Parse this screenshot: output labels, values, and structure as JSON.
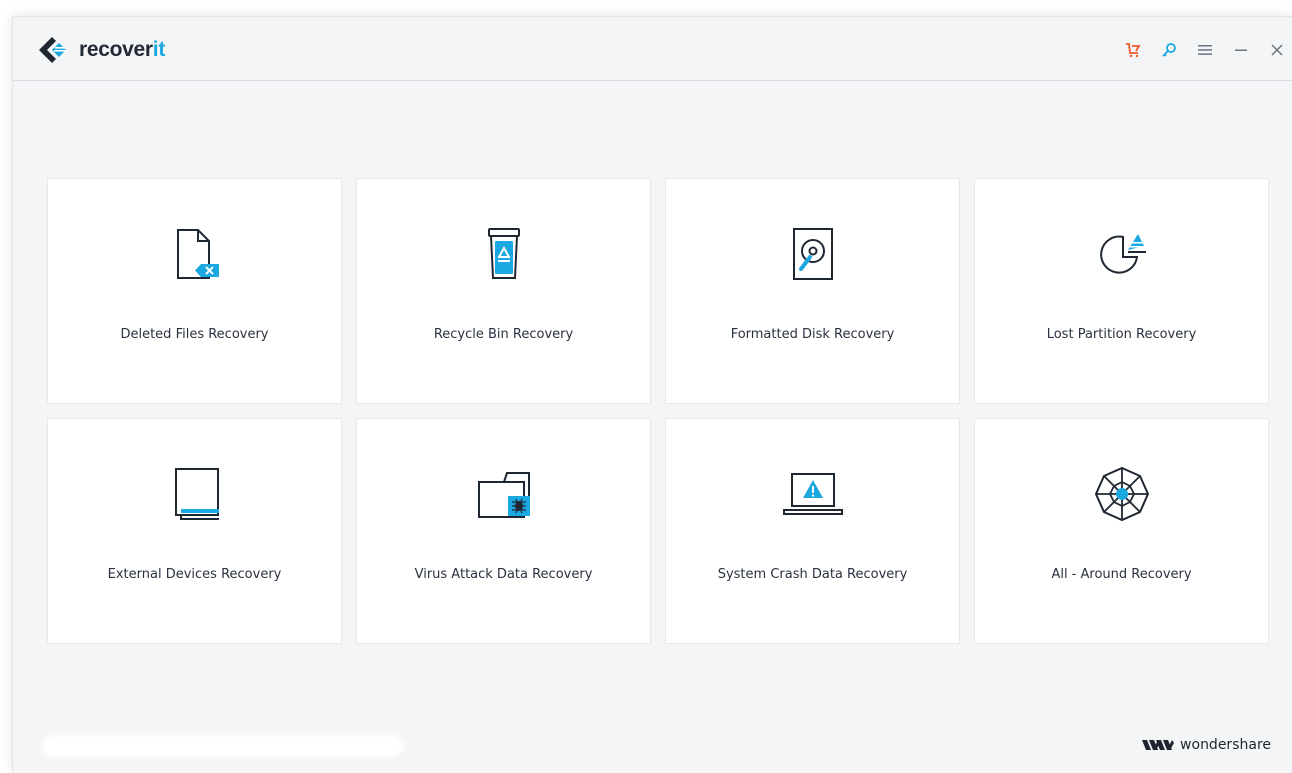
{
  "app": {
    "logo_text_main": "recover",
    "logo_text_accent": "it",
    "logo_icon": "recoverit-diamond-logo",
    "colors": {
      "accent": "#1ba8e0",
      "cart": "#f05a28",
      "text": "#2a3140"
    }
  },
  "titlebar": {
    "icons": [
      {
        "name": "cart-icon",
        "title": "Buy"
      },
      {
        "name": "key-icon",
        "title": "Register"
      },
      {
        "name": "menu-icon",
        "title": "Menu"
      },
      {
        "name": "minimize-icon",
        "title": "Minimize"
      },
      {
        "name": "close-icon",
        "title": "Close"
      }
    ]
  },
  "modes": [
    {
      "label": "Deleted Files Recovery",
      "icon": "deleted-file-icon"
    },
    {
      "label": "Recycle Bin Recovery",
      "icon": "recycle-bin-icon"
    },
    {
      "label": "Formatted Disk Recovery",
      "icon": "hard-disk-icon"
    },
    {
      "label": "Lost Partition Recovery",
      "icon": "partition-pie-icon"
    },
    {
      "label": "External Devices Recovery",
      "icon": "external-device-icon"
    },
    {
      "label": "Virus Attack Data Recovery",
      "icon": "virus-folder-icon"
    },
    {
      "label": "System Crash Data Recovery",
      "icon": "crashed-laptop-icon"
    },
    {
      "label": "All - Around Recovery",
      "icon": "web-network-icon"
    }
  ],
  "footer": {
    "brand": "wondershare",
    "brand_icon": "wondershare-logo"
  }
}
